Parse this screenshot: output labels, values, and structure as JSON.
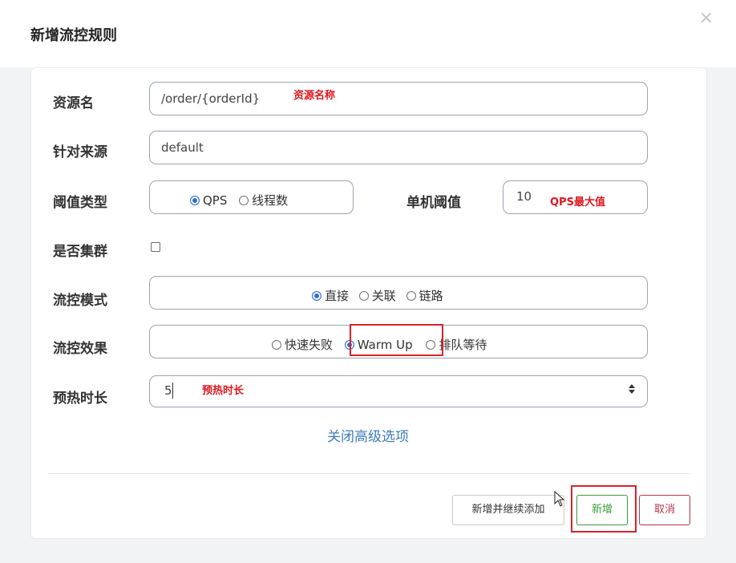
{
  "dialog": {
    "title": "新增流控规则",
    "close_icon": "×"
  },
  "form": {
    "resource": {
      "label": "资源名",
      "value": "/order/{orderId}",
      "annotation": "资源名称"
    },
    "origin": {
      "label": "针对来源",
      "value": "default"
    },
    "threshold_type": {
      "label": "阈值类型",
      "options": [
        "QPS",
        "线程数"
      ],
      "selected": "QPS"
    },
    "single_threshold": {
      "label": "单机阈值",
      "value": "10",
      "annotation": "QPS最大值"
    },
    "cluster": {
      "label": "是否集群",
      "checked": false
    },
    "flow_mode": {
      "label": "流控模式",
      "options": [
        "直接",
        "关联",
        "链路"
      ],
      "selected": "直接"
    },
    "flow_effect": {
      "label": "流控效果",
      "options": [
        "快速失败",
        "Warm Up",
        "排队等待"
      ],
      "selected": "Warm Up"
    },
    "warmup": {
      "label": "预热时长",
      "value": "5",
      "annotation": "预热时长"
    },
    "advanced_link": "关闭高级选项"
  },
  "footer": {
    "add_continue_label": "新增并继续添加",
    "add_label": "新增",
    "cancel_label": "取消"
  },
  "colors": {
    "annotation": "#e0171f",
    "highlight_box": "#d9222a",
    "add_button": "#3a9a3a",
    "cancel_button": "#b0364a",
    "link": "#3d7bbf"
  }
}
